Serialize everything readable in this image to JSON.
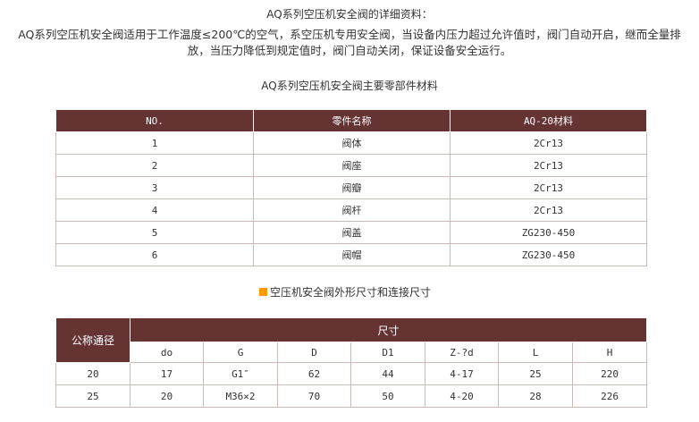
{
  "detail_title": "AQ系列空压机安全阀的详细资料：",
  "intro": "AQ系列空压机安全阀适用于工作温度≤200℃的空气，系空压机专用安全阀，当设备内压力超过允许值时，阀门自动开启，继而全量排放，当压力降低到规定值时，阀门自动关闭，保证设备安全运行。",
  "parts_title": "AQ系列空压机安全阀主要零部件材料",
  "parts_table": {
    "headers": [
      "NO.",
      "零件名称",
      "AQ-20材料"
    ],
    "rows": [
      [
        "1",
        "阀体",
        "2Cr13"
      ],
      [
        "2",
        "阀座",
        "2Cr13"
      ],
      [
        "3",
        "阀瓣",
        "2Cr13"
      ],
      [
        "4",
        "阀杆",
        "2Cr13"
      ],
      [
        "5",
        "阀盖",
        "ZG230-450"
      ],
      [
        "6",
        "阀帽",
        "ZG230-450"
      ]
    ]
  },
  "dims_title": "空压机安全阀外形尺寸和连接尺寸",
  "dims_table": {
    "nominal_label": "公称通径",
    "size_label": "尺寸",
    "sub_headers": [
      "do",
      "G",
      "D",
      "D1",
      "Z-?d",
      "L",
      "H"
    ],
    "rows": [
      [
        "20",
        "17",
        "G1″",
        "62",
        "44",
        "4-17",
        "25",
        "220"
      ],
      [
        "25",
        "20",
        "M36×2",
        "70",
        "50",
        "4-20",
        "28",
        "226"
      ]
    ]
  },
  "colors": {
    "header_bg": "#663333",
    "bullet": "#ff9900",
    "border": "#c9b9b9"
  }
}
